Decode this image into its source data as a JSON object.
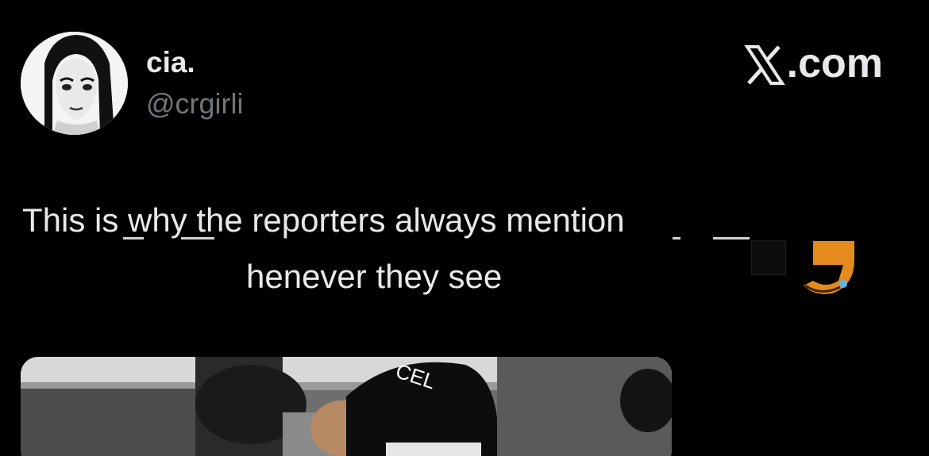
{
  "user": {
    "display_name": "cia.",
    "handle": "@crgirli"
  },
  "brand": {
    "domain_text": ".com",
    "logo_icon": "x-logo-icon"
  },
  "tweet": {
    "line_1": "This is why the reporters always mention",
    "line_2": "henever they see"
  },
  "media": {
    "hat_text": "CEL"
  },
  "colors": {
    "background": "#000000",
    "primary_text": "#e7e9ea",
    "secondary_text": "#71767b",
    "emoji_orange": "#e58a1d"
  }
}
